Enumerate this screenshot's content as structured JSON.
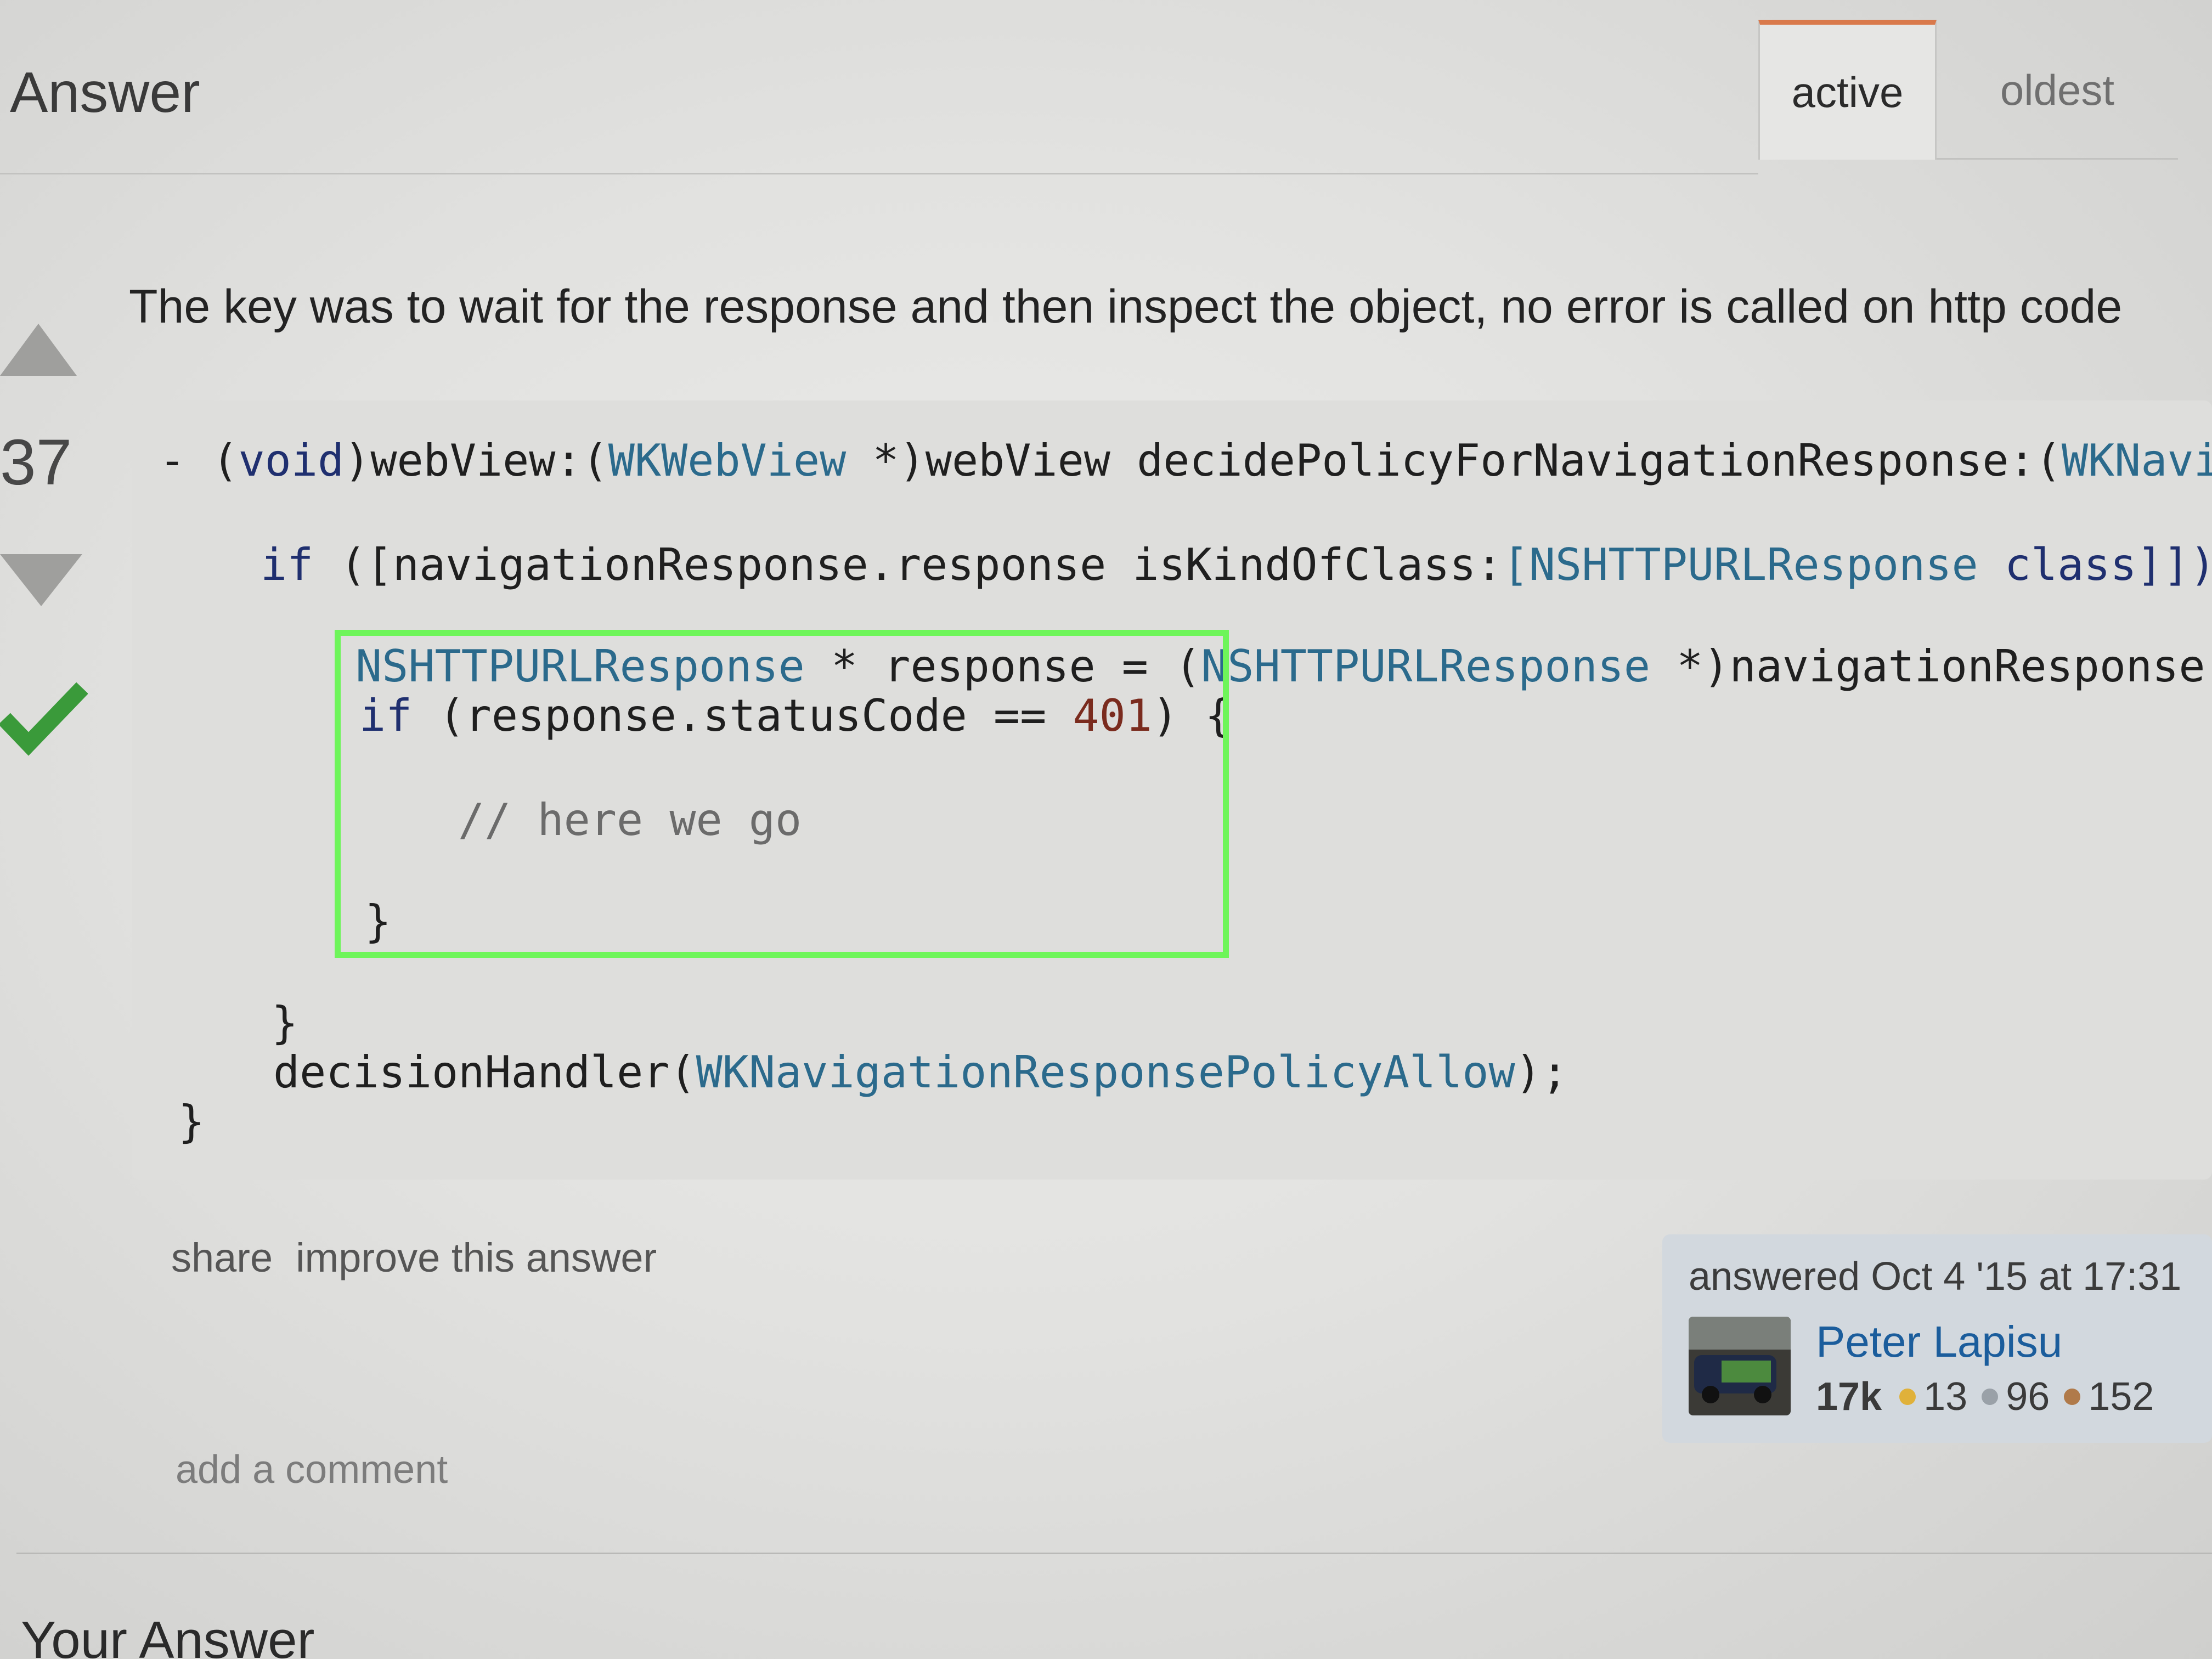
{
  "header": {
    "title": "Answer",
    "tabs": [
      {
        "label": "active",
        "selected": true
      },
      {
        "label": "oldest",
        "selected": false
      }
    ]
  },
  "post": {
    "votes": "37",
    "accepted": true,
    "accepted_color": "#3a9a3a",
    "text": "The key was to wait for the response and then inspect the object, no error is called on http code",
    "code": {
      "l1": {
        "a": "- (",
        "b": "void",
        "c": ")webView:(",
        "d": "WKWebView",
        "e": " *)webView decidePolicyForNavigationResponse:(",
        "f": "WKNavigat"
      },
      "l2": {
        "a": "if",
        "b": " ([navigationResponse.response isKindOfClass:",
        "c": "[NSHTTPURLResponse",
        "d": " class]]) {"
      },
      "l3": {
        "a": "NSHTTPURLResponse",
        "b": " * response = (",
        "c": "NSHTTPURLResponse",
        "d": " *)navigationResponse.re"
      },
      "l4": {
        "a": "if",
        "b": " (response.statusCode == ",
        "c": "401",
        "d": ") {"
      },
      "l5": {
        "a": "// here we go"
      },
      "l6": {
        "a": "}"
      },
      "l7": {
        "a": "}"
      },
      "l8": {
        "a": "decisionHandler(",
        "b": "WKNavigationResponsePolicyAllow",
        "c": ");"
      },
      "l9": {
        "a": "}"
      }
    },
    "highlight_color": "#6ef55a",
    "menu": {
      "share": "share",
      "improve": "improve this answer"
    },
    "user_card": {
      "answered": "answered Oct 4 '15 at 17:31",
      "name": "Peter Lapisu",
      "reputation": "17k",
      "gold": "13",
      "silver": "96",
      "bronze": "152",
      "gold_color": "#e0b13a",
      "silver_color": "#9aa1a8",
      "bronze_color": "#b07a4a"
    },
    "add_comment": "add a comment"
  },
  "footer": {
    "your_answer": "Your Answer"
  }
}
